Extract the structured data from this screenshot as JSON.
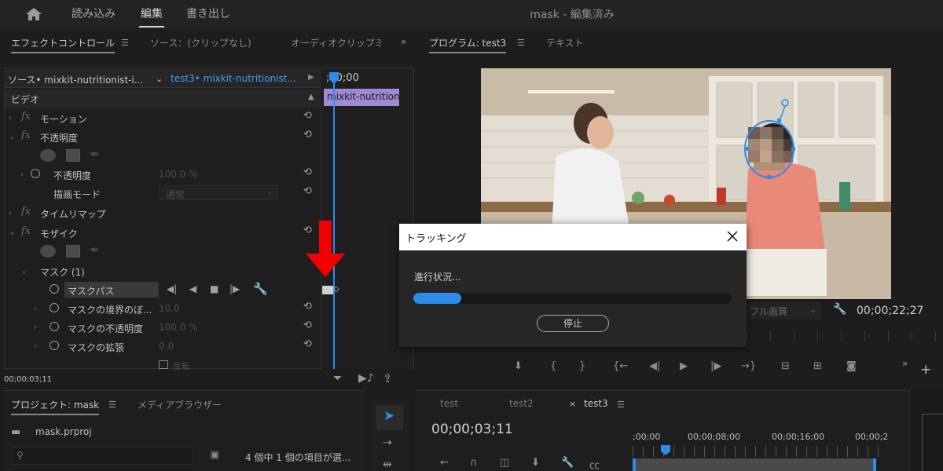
{
  "topbar": {
    "workspaces": [
      "読み込み",
      "編集",
      "書き出し"
    ],
    "active_workspace": "編集",
    "window_title": "mask - 編集済み"
  },
  "effect_controls": {
    "tabs": [
      "エフェクトコントロール",
      "ソース：(クリップなし)",
      "オーディオクリップミ"
    ],
    "source_label": "ソース• mixkit-nutritionist-i...",
    "sequence_label": "test3• mixkit-nutritionist...",
    "timecode_top": ";00;00",
    "clip_name": "mixkit-nutrition",
    "section_video": "ビデオ",
    "rows": {
      "motion": "モーション",
      "opacity": "不透明度",
      "opacity_param": "不透明度",
      "opacity_value": "100.0 %",
      "blend_mode": "描画モード",
      "blend_value": "通常",
      "time_remap": "タイムリマップ",
      "mosaic": "モザイク",
      "mask": "マスク (1)",
      "mask_path": "マスクパス",
      "mask_feather": "マスクの境界のぼ...",
      "mask_feather_value": "10.0",
      "mask_opacity": "マスクの不透明度",
      "mask_opacity_value": "100.0 %",
      "mask_expansion": "マスクの拡張",
      "mask_expansion_value": "0.0",
      "invert": "反転"
    },
    "timecode_bottom": "00;00;03;11",
    "accent_color": "#2d8ceb",
    "clip_color": "#9f88d4"
  },
  "program": {
    "tabs": [
      "プログラム: test3",
      "テキスト"
    ],
    "quality": "フル画質",
    "timecode": "00;00;22;27"
  },
  "dialog": {
    "title": "トラッキング",
    "status": "進行状況...",
    "progress_percent": 15,
    "stop_label": "停止"
  },
  "project": {
    "tabs": [
      "プロジェクト: mask",
      "メディアブラウザー"
    ],
    "file": "mask.prproj",
    "selection": "4 個中 1 個の項目が選..."
  },
  "sequence": {
    "tabs": [
      "test",
      "test2",
      "test3"
    ],
    "timecode": "00;00;03;11",
    "ruler": [
      ";00;00",
      "00;00;08;00",
      "00;00;16;00",
      "00;00;2"
    ]
  }
}
